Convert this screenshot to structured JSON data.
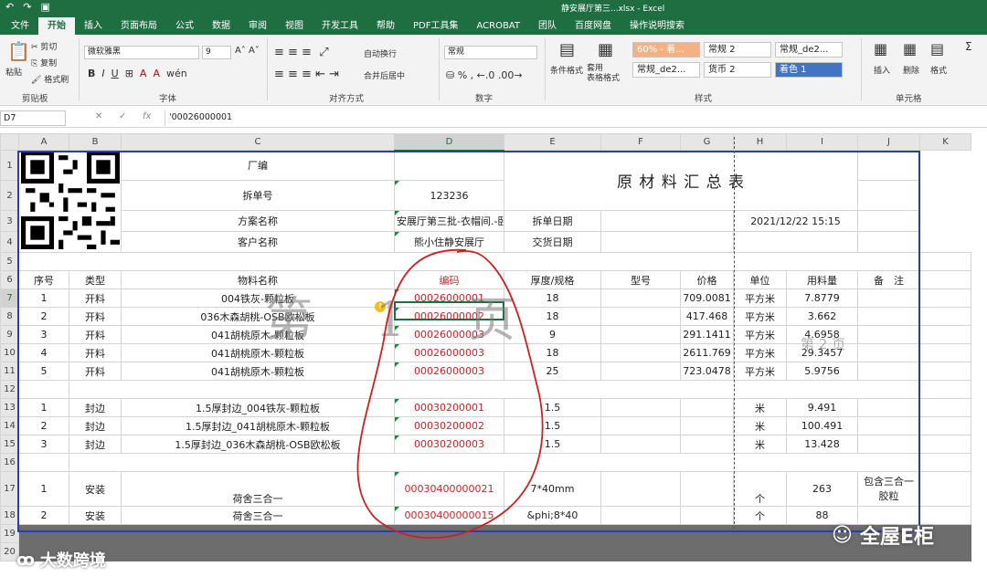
{
  "titlebar": {
    "title": "静安展厅第三...xlsx  -  Excel"
  },
  "ribbon_tabs": [
    "文件",
    "开始",
    "插入",
    "页面布局",
    "公式",
    "数据",
    "审阅",
    "视图",
    "开发工具",
    "帮助",
    "PDF工具集",
    "ACROBAT",
    "团队",
    "百度网盘",
    "操作说明搜索"
  ],
  "ribbon": {
    "paste": "粘贴",
    "cut": "剪切",
    "copy": "复制",
    "format_painter": "格式刷",
    "clipboard": "剪贴板",
    "font_name": "微软雅黑",
    "font_size": "9",
    "font_group": "字体",
    "wrap": "自动换行",
    "merge": "合并后居中",
    "align_group": "对齐方式",
    "number_format": "常规",
    "number_group": "数字",
    "cond_format": "条件格式",
    "table_format": "套用\n表格格式",
    "styles_group": "样式",
    "style_cells": [
      "60% - 着...",
      "常规 2",
      "常规_de2...",
      "常规_de2...",
      "货币 2",
      "着色 1"
    ],
    "insert": "插入",
    "delete": "删除",
    "format": "格式",
    "cells_group": "单元格"
  },
  "formula_bar": {
    "name_box": "D7",
    "value": "'00026000001"
  },
  "columns": [
    "A",
    "B",
    "C",
    "D",
    "E",
    "F",
    "G",
    "H",
    "I",
    "J",
    "K"
  ],
  "rows_header": [
    "1",
    "2",
    "3",
    "4",
    "5",
    "6",
    "7",
    "8",
    "9",
    "10",
    "11",
    "12",
    "13",
    "14",
    "15",
    "16",
    "17",
    "18",
    "19",
    "20"
  ],
  "sheet": {
    "changbian": "厂编",
    "chaidanhao": "拆单号",
    "chaidanhao_val": "123236",
    "title": "原 材 料 汇 总 表",
    "fangan": "方案名称",
    "fangan_val": "安展厅第三批-衣帽间.-卧",
    "chaidan_date": "拆单日期",
    "date_val": "2021/12/22 15:15",
    "customer": "客户名称",
    "customer_val": "熊小住静安展厅",
    "delivery": "交货日期",
    "headers": [
      "序号",
      "类型",
      "物料名称",
      "编码",
      "厚度/规格",
      "型号",
      "价格",
      "单位",
      "用料量",
      "备　注"
    ],
    "rows": [
      {
        "r": "7",
        "no": "1",
        "type": "开料",
        "name": "004铁灰-颗粒板",
        "code": "00026000001",
        "spec": "18",
        "model": "",
        "price": "709.0081",
        "unit": "平方米",
        "qty": "7.8779",
        "note": ""
      },
      {
        "r": "8",
        "no": "2",
        "type": "开料",
        "name": "036木森胡桃-OSB欧松板",
        "code": "00026000002",
        "spec": "18",
        "model": "",
        "price": "417.468",
        "unit": "平方米",
        "qty": "3.662",
        "note": ""
      },
      {
        "r": "9",
        "no": "3",
        "type": "开料",
        "name": "041胡桃原木-颗粒板",
        "code": "00026000003",
        "spec": "9",
        "model": "",
        "price": "291.1411",
        "unit": "平方米",
        "qty": "4.6958",
        "note": ""
      },
      {
        "r": "10",
        "no": "4",
        "type": "开料",
        "name": "041胡桃原木-颗粒板",
        "code": "00026000003",
        "spec": "18",
        "model": "",
        "price": "2611.769",
        "unit": "平方米",
        "qty": "29.3457",
        "note": ""
      },
      {
        "r": "11",
        "no": "5",
        "type": "开料",
        "name": "041胡桃原木-颗粒板",
        "code": "00026000003",
        "spec": "25",
        "model": "",
        "price": "723.0478",
        "unit": "平方米",
        "qty": "5.9756",
        "note": ""
      },
      {
        "r": "13",
        "no": "1",
        "type": "封边",
        "name": "1.5厚封边_004铁灰-颗粒板",
        "code": "00030200001",
        "spec": "1.5",
        "model": "",
        "price": "",
        "unit": "米",
        "qty": "9.491",
        "note": ""
      },
      {
        "r": "14",
        "no": "2",
        "type": "封边",
        "name": "1.5厚封边_041胡桃原木-颗粒板",
        "code": "00030200002",
        "spec": "1.5",
        "model": "",
        "price": "",
        "unit": "米",
        "qty": "100.491",
        "note": ""
      },
      {
        "r": "15",
        "no": "3",
        "type": "封边",
        "name": "1.5厚封边_036木森胡桃-OSB欧松板",
        "code": "00030200003",
        "spec": "1.5",
        "model": "",
        "price": "",
        "unit": "米",
        "qty": "13.428",
        "note": ""
      },
      {
        "r": "17",
        "no": "1",
        "type": "安装",
        "name": "荷舍三合一",
        "code": "00030400000021",
        "spec": "7*40mm",
        "model": "",
        "price": "",
        "unit": "个",
        "qty": "263",
        "note": "包含三合一胶粒"
      },
      {
        "r": "18",
        "no": "2",
        "type": "安装",
        "name": "荷舍三合一",
        "code": "00030400000015",
        "spec": "&phi;8*40",
        "model": "",
        "price": "",
        "unit": "个",
        "qty": "88",
        "note": ""
      }
    ]
  },
  "overlay": {
    "watermark": "第 1 页",
    "page_label": "第 2 页"
  },
  "logos": {
    "left": "大数跨境",
    "right": "全屋E柜"
  }
}
